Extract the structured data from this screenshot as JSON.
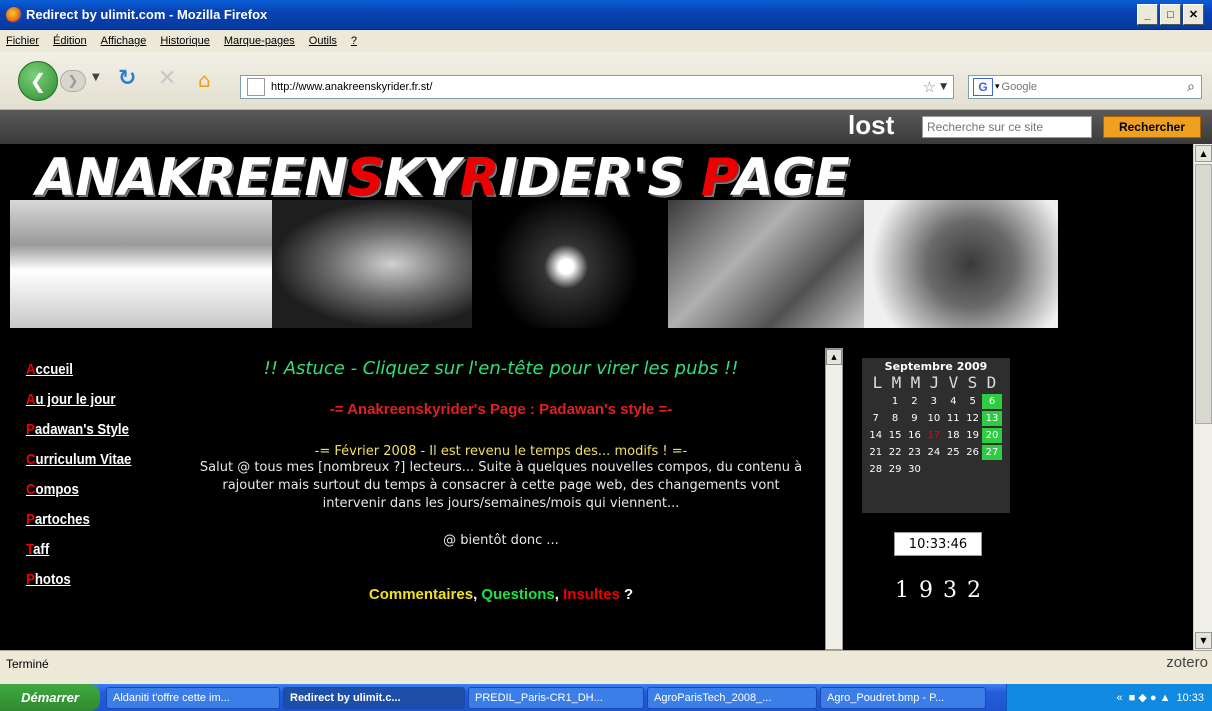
{
  "window": {
    "title": "Redirect by ulimit.com - Mozilla Firefox"
  },
  "menu": [
    "Fichier",
    "Édition",
    "Affichage",
    "Historique",
    "Marque-pages",
    "Outils",
    "?"
  ],
  "nav": {
    "url": "http://www.anakreenskyrider.fr.st/",
    "search_placeholder": "Google"
  },
  "site": {
    "logo": "lost",
    "search_placeholder": "Recherche sur ce site",
    "search_button": "Rechercher",
    "banner_parts": [
      "ANAKREEN",
      "S",
      "KY",
      "R",
      "IDER'S ",
      "P",
      "AGE"
    ]
  },
  "leftnav": [
    {
      "first": "A",
      "rest": "ccueil"
    },
    {
      "first": "A",
      "rest": "u jour le jour"
    },
    {
      "first": "P",
      "rest": "adawan's Style"
    },
    {
      "first": "C",
      "rest": "urriculum Vitae"
    },
    {
      "first": "C",
      "rest": "ompos"
    },
    {
      "first": "P",
      "rest": "artoches"
    },
    {
      "first": "T",
      "rest": "aff"
    },
    {
      "first": "P",
      "rest": "hotos"
    }
  ],
  "content": {
    "astuce": "!! Astuce - Cliquez sur l'en-tête pour virer les pubs !!",
    "style": "-= Anakreenskyrider's Page : Padawan's style =-",
    "fevrier": "-= Février 2008 - Il est revenu le temps des... modifs ! =-",
    "body": "Salut @ tous mes [nombreux ?] lecteurs... Suite à quelques nouvelles compos, du contenu à rajouter mais surtout du temps à consacrer à cette page web, des changements vont intervenir dans les jours/semaines/mois qui viennent...",
    "bientot": "@ bientôt donc ...",
    "comments": {
      "c1": "Commentaires",
      "c2": "Questions",
      "c3": "Insultes",
      "end": " ?"
    }
  },
  "calendar": {
    "month": "Septembre 2009",
    "dow": [
      "L",
      "M",
      "M",
      "J",
      "V",
      "S",
      "D"
    ],
    "weeks": [
      [
        "",
        "1",
        "2",
        "3",
        "4",
        "5",
        "6"
      ],
      [
        "7",
        "8",
        "9",
        "10",
        "11",
        "12",
        "13"
      ],
      [
        "14",
        "15",
        "16",
        "17",
        "18",
        "19",
        "20"
      ],
      [
        "21",
        "22",
        "23",
        "24",
        "25",
        "26",
        "27"
      ],
      [
        "28",
        "29",
        "30",
        "",
        "",
        "",
        ""
      ]
    ],
    "today": "17",
    "clock": "10:33:46",
    "counter": "1932"
  },
  "status": {
    "text": "Terminé",
    "zotero": "zotero"
  },
  "taskbar": {
    "start": "Démarrer",
    "tasks": [
      "Aldaniti t'offre cette im...",
      "Redirect by ulimit.c...",
      "PREDIL_Paris-CR1_DH...",
      "AgroParisTech_2008_...",
      "Agro_Poudret.bmp - P..."
    ],
    "time": "10:33"
  }
}
